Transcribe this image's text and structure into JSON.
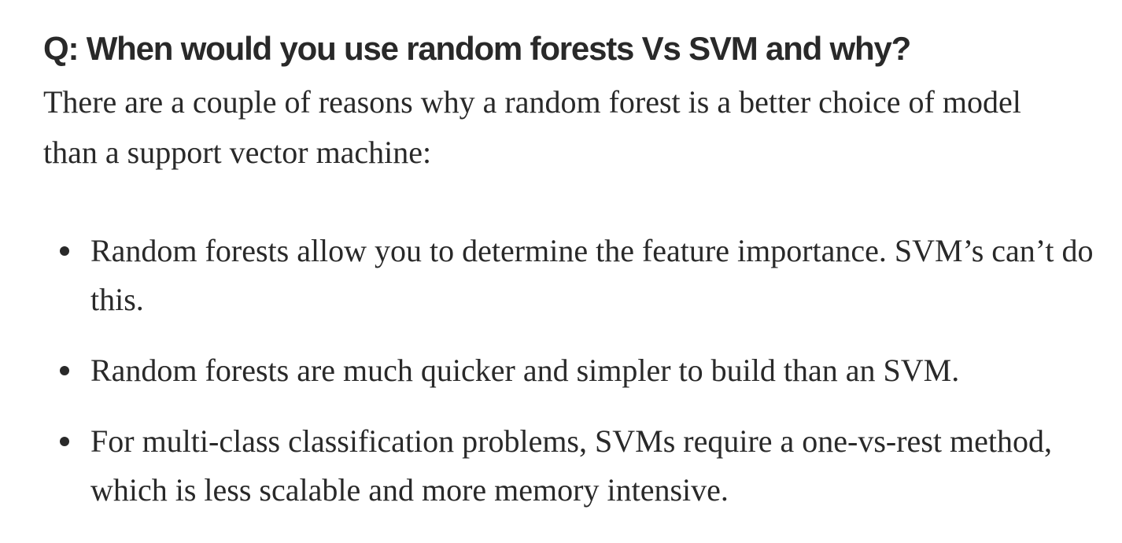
{
  "article": {
    "heading": "Q: When would you use random forests Vs SVM and why?",
    "intro": "There are a couple of reasons why a random forest is a better choice of model than a support vector machine:",
    "bullets": [
      "Random forests allow you to determine the feature importance. SVM’s can’t do this.",
      "Random forests are much quicker and simpler to build than an SVM.",
      "For multi-class classification problems, SVMs require a one-vs-rest method, which is less scalable and more memory intensive."
    ]
  },
  "colors": {
    "text": "#292929",
    "background": "#ffffff"
  }
}
